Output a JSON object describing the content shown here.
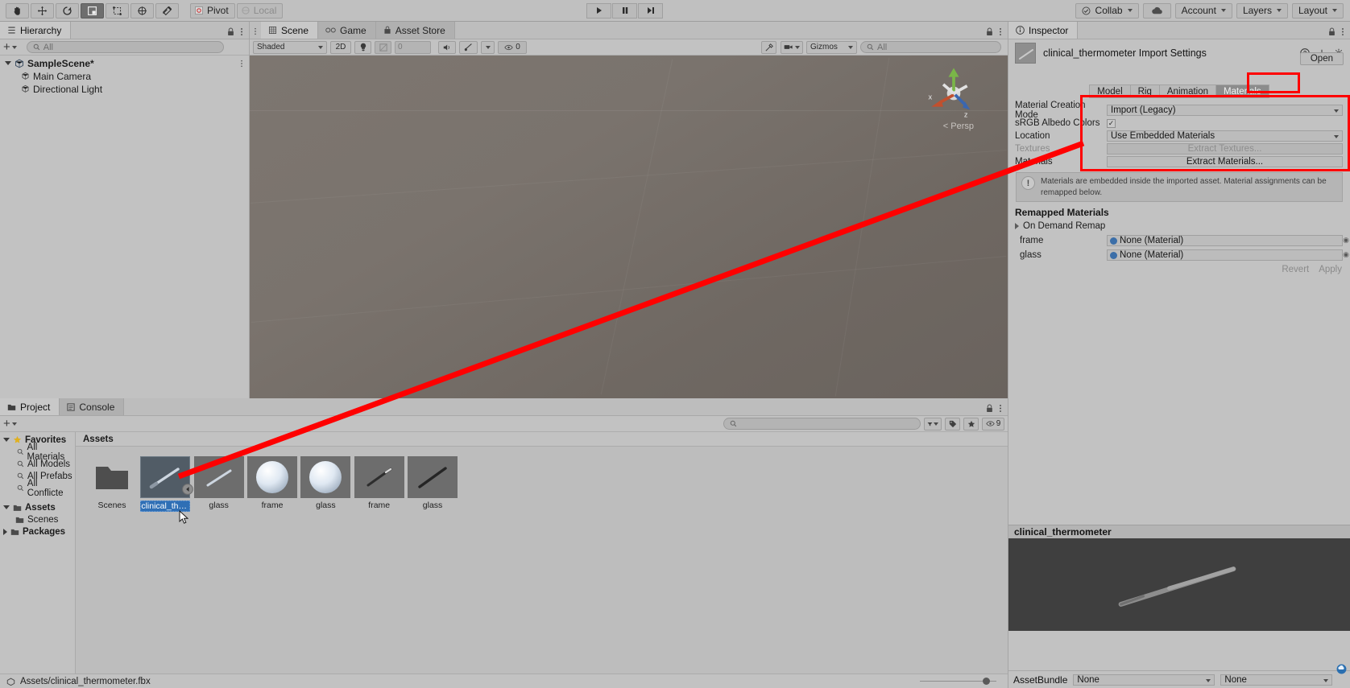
{
  "toolbar": {
    "tools": [
      {
        "name": "hand-tool",
        "glyph": "✋"
      },
      {
        "name": "move-tool",
        "glyph": "✥"
      },
      {
        "name": "rotate-tool",
        "glyph": "↻"
      },
      {
        "name": "scale-tool",
        "glyph": "⧉"
      },
      {
        "name": "rect-tool",
        "glyph": "⬚"
      },
      {
        "name": "transform-tool",
        "glyph": "✲"
      },
      {
        "name": "custom-editor-tool",
        "glyph": "⚒"
      }
    ],
    "pivot_label": "Pivot",
    "local_label": "Local",
    "play_label": "▶",
    "pause_label": "❚❚",
    "step_label": "▶❙",
    "collab_label": "Collab",
    "cloud_label": "cloud-icon",
    "account_label": "Account",
    "layers_label": "Layers",
    "layout_label": "Layout"
  },
  "hierarchy": {
    "tab_label": "Hierarchy",
    "create_label": "+",
    "search_placeholder": "All",
    "items": [
      {
        "label": "SampleScene*",
        "depth": 0,
        "icon": "scene-icon"
      },
      {
        "label": "Main Camera",
        "depth": 1,
        "icon": "gameobject-icon"
      },
      {
        "label": "Directional Light",
        "depth": 1,
        "icon": "gameobject-icon"
      }
    ]
  },
  "scene": {
    "tabs": [
      {
        "label": "Scene",
        "icon": "scene-grid-icon",
        "active": true
      },
      {
        "label": "Game",
        "icon": "game-icon",
        "active": false
      },
      {
        "label": "Asset Store",
        "icon": "store-icon",
        "active": false
      }
    ],
    "shading_mode": "Shaded",
    "mode_2d": "2D",
    "light_toggle": "light-icon",
    "audio_toggle": "audio-icon",
    "fx_value": "0",
    "gizmos_label": "Gizmos",
    "gizmo_count": "0",
    "scene_search_placeholder": "All",
    "persp_label": "Persp",
    "gizmo_axes": [
      "x",
      "y",
      "z"
    ]
  },
  "inspector": {
    "tab_label": "Inspector",
    "title": "clinical_thermometer Import Settings",
    "open_label": "Open",
    "tabs": [
      {
        "label": "Model",
        "active": false
      },
      {
        "label": "Rig",
        "active": false
      },
      {
        "label": "Animation",
        "active": false
      },
      {
        "label": "Materials",
        "active": true
      }
    ],
    "properties": [
      {
        "label": "Material Creation Mode",
        "value": "Import (Legacy)",
        "type": "dropdown"
      },
      {
        "label": "sRGB Albedo Colors",
        "value": "✓",
        "type": "checkbox"
      },
      {
        "label": "Location",
        "value": "Use Embedded Materials",
        "type": "dropdown"
      },
      {
        "label": "Textures",
        "value": "Extract Textures...",
        "type": "button",
        "disabled": true
      },
      {
        "label": "Materials",
        "value": "Extract Materials...",
        "type": "button",
        "disabled": false
      }
    ],
    "help_text": "Materials are embedded inside the imported asset. Material assignments can be remapped below.",
    "remapped_title": "Remapped Materials",
    "on_demand_remap": "On Demand Remap",
    "remap_rows": [
      {
        "label": "frame",
        "value": "None (Material)"
      },
      {
        "label": "glass",
        "value": "None (Material)"
      }
    ],
    "revert_label": "Revert",
    "apply_label": "Apply",
    "preview_title": "clinical_thermometer",
    "assetbundle_label": "AssetBundle",
    "assetbundle_value": "None",
    "assetbundle_variant": "None"
  },
  "project": {
    "tabs": [
      {
        "label": "Project",
        "icon": "folder-icon",
        "active": true
      },
      {
        "label": "Console",
        "icon": "console-icon",
        "active": false
      }
    ],
    "create_label": "+",
    "search_placeholder": "",
    "favorites_label": "Favorites",
    "favorites": [
      {
        "label": "All Materials"
      },
      {
        "label": "All Models"
      },
      {
        "label": "All Prefabs"
      },
      {
        "label": "All Conflicte"
      }
    ],
    "tree": [
      {
        "label": "Assets",
        "depth": 0,
        "bold": true,
        "expanded": true
      },
      {
        "label": "Scenes",
        "depth": 1,
        "bold": false,
        "expanded": false
      },
      {
        "label": "Packages",
        "depth": 0,
        "bold": true,
        "expanded": false
      }
    ],
    "breadcrumb": "Assets",
    "assets": [
      {
        "label": "Scenes",
        "type": "folder",
        "selected": false
      },
      {
        "label": "clinical_the...",
        "type": "model",
        "selected": true
      },
      {
        "label": "glass",
        "type": "model",
        "selected": false
      },
      {
        "label": "frame",
        "type": "material",
        "selected": false
      },
      {
        "label": "glass",
        "type": "material",
        "selected": false
      },
      {
        "label": "frame",
        "type": "model-dark",
        "selected": false
      },
      {
        "label": "glass",
        "type": "model-dark",
        "selected": false
      }
    ],
    "status_path": "Assets/clinical_thermometer.fbx",
    "item_count": "9"
  }
}
